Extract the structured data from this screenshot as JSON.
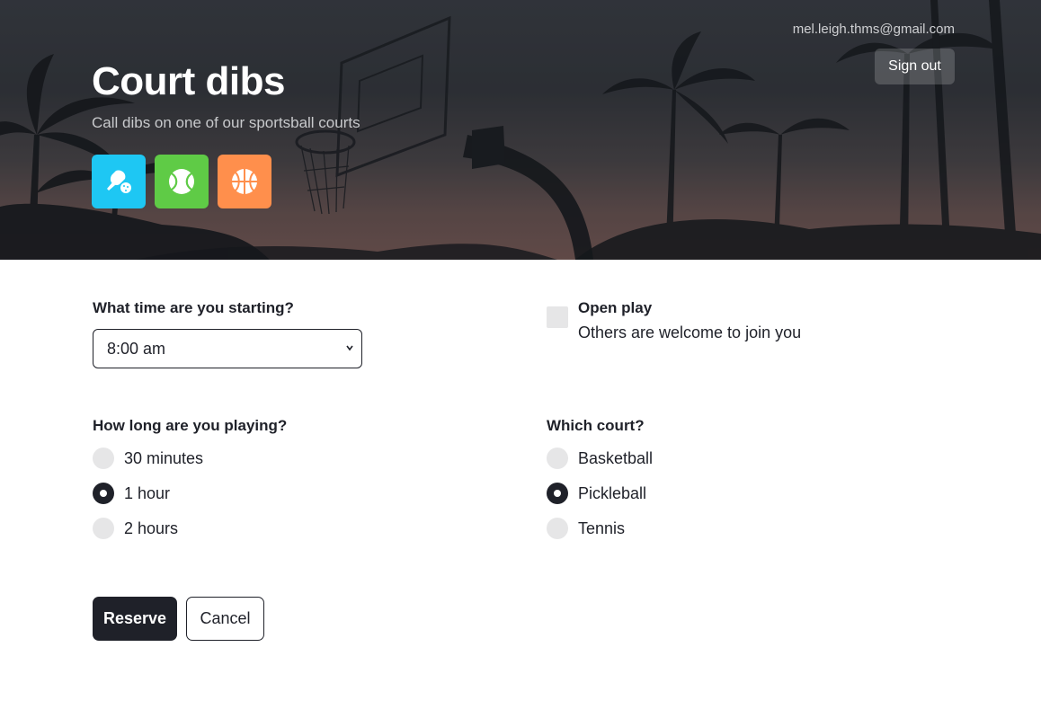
{
  "header": {
    "title": "Court dibs",
    "subtitle": "Call dibs on one of our sportsball courts",
    "user_email": "mel.leigh.thms@gmail.com",
    "sign_out_label": "Sign out",
    "sports": [
      {
        "icon": "pickleball-icon",
        "color": "#1ec7f3"
      },
      {
        "icon": "tennis-ball-icon",
        "color": "#5fcb46"
      },
      {
        "icon": "basketball-icon",
        "color": "#ff8f4c"
      }
    ]
  },
  "form": {
    "start_time": {
      "label": "What time are you starting?",
      "selected": "8:00 am"
    },
    "open_play": {
      "title": "Open play",
      "description": "Others are welcome to join you",
      "checked": false
    },
    "duration": {
      "label": "How long are you playing?",
      "options": [
        {
          "label": "30 minutes",
          "selected": false
        },
        {
          "label": "1 hour",
          "selected": true
        },
        {
          "label": "2 hours",
          "selected": false
        }
      ]
    },
    "court": {
      "label": "Which court?",
      "options": [
        {
          "label": "Basketball",
          "selected": false
        },
        {
          "label": "Pickleball",
          "selected": true
        },
        {
          "label": "Tennis",
          "selected": false
        }
      ]
    },
    "reserve_label": "Reserve",
    "cancel_label": "Cancel"
  },
  "colors": {
    "dark": "#1f2129",
    "control_bg": "#e6e6e7"
  }
}
